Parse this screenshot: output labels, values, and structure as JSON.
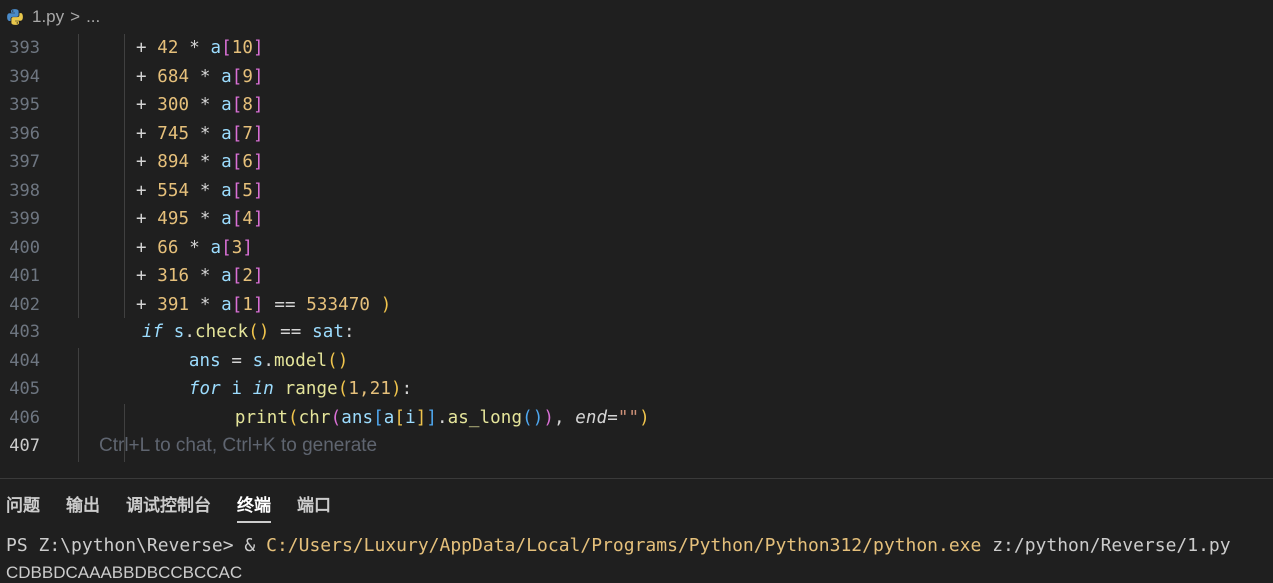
{
  "breadcrumb": {
    "file": "1.py",
    "separator": ">",
    "more": "..."
  },
  "lines": [
    {
      "n": "393",
      "coef": "42",
      "idx": "10"
    },
    {
      "n": "394",
      "coef": "684",
      "idx": "9"
    },
    {
      "n": "395",
      "coef": "300",
      "idx": "8"
    },
    {
      "n": "396",
      "coef": "745",
      "idx": "7"
    },
    {
      "n": "397",
      "coef": "894",
      "idx": "6"
    },
    {
      "n": "398",
      "coef": "554",
      "idx": "5"
    },
    {
      "n": "399",
      "coef": "495",
      "idx": "4"
    },
    {
      "n": "400",
      "coef": "66",
      "idx": "3"
    },
    {
      "n": "401",
      "coef": "316",
      "idx": "2"
    },
    {
      "n": "402",
      "coef": "391",
      "idx": "1",
      "tail": "533470"
    }
  ],
  "code": {
    "n403": "403",
    "n404": "404",
    "n405": "405",
    "n406": "406",
    "n407": "407",
    "if_kw": "if",
    "s1": "s",
    "check": "check",
    "eq": "==",
    "sat": "sat",
    "ans": "ans",
    "s2": "s",
    "model": "model",
    "for_kw": "for",
    "i_var": "i",
    "in_kw": "in",
    "range": "range",
    "range_args": "1,21",
    "print": "print",
    "chr": "chr",
    "ans2": "ans",
    "a2": "a",
    "i2": "i",
    "as_long": "as_long",
    "end": "end",
    "str": "\"\"",
    "hint": "Ctrl+L to chat, Ctrl+K to generate"
  },
  "panel": {
    "tabs": [
      "问题",
      "输出",
      "调试控制台",
      "终端",
      "端口"
    ],
    "active_tab": "终端",
    "prompt": "PS Z:\\python\\Reverse> ",
    "amp": "& ",
    "exe": "C:/Users/Luxury/AppData/Local/Programs/Python/Python312/python.exe",
    "arg": " z:/python/Reverse/1.py",
    "output": "CDBBDCAAABBDBCCBCCAC"
  },
  "colors": {
    "background": "#1f1f1f",
    "number": "#e6c07b",
    "variable": "#9cdcfe",
    "bracket2": "#da70d6"
  }
}
